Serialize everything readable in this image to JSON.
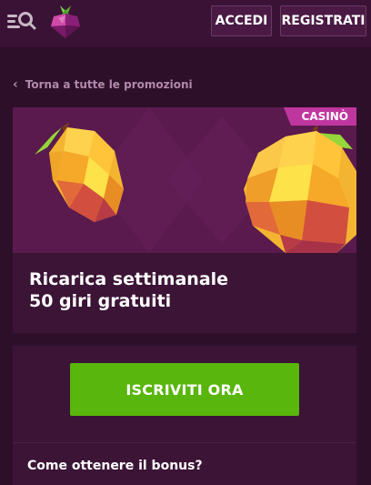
{
  "header": {
    "login_label": "ACCEDI",
    "register_label": "REGISTRATI"
  },
  "navigation": {
    "back_label": "Torna a tutte le promozioni"
  },
  "promo": {
    "category_badge": "CASINÒ",
    "title_line1": "Ricarica settimanale",
    "title_line2": "50 giri gratuiti",
    "cta_label": "ISCRIVITI ORA",
    "section_question": "Come ottenere il bonus?"
  },
  "icons": {
    "menu": "menu-search-icon",
    "logo": "raspberry-logo",
    "back": "chevron-left-icon"
  },
  "colors": {
    "background": "#2e0f2a",
    "topbar": "#3a1235",
    "card": "#3b1436",
    "hero": "#5a1a4d",
    "badge": "#c0369f",
    "cta": "#58b60c"
  }
}
